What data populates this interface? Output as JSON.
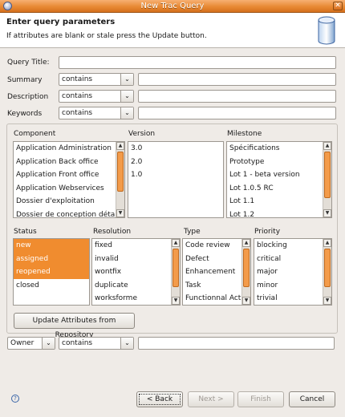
{
  "window": {
    "title": "New Trac Query"
  },
  "header": {
    "title": "Enter query parameters",
    "subtitle": "If attributes are blank or stale press the Update button."
  },
  "fields": {
    "query_title_label": "Query Title:",
    "summary_label": "Summary",
    "summary_op": "contains",
    "description_label": "Description",
    "description_op": "contains",
    "keywords_label": "Keywords",
    "keywords_op": "contains"
  },
  "component": {
    "label": "Component",
    "items": [
      "Application Administration",
      "Application Back office",
      "Application Front office",
      "Application Webservices",
      "Dossier d'exploitation",
      "Dossier de conception détaillé"
    ]
  },
  "version": {
    "label": "Version",
    "items": [
      "3.0",
      "2.0",
      "1.0"
    ]
  },
  "milestone": {
    "label": "Milestone",
    "items": [
      "Spécifications",
      "Prototype",
      "Lot 1 - beta version",
      "Lot 1.0.5 RC",
      "Lot 1.1",
      "Lot 1.2"
    ]
  },
  "status": {
    "label": "Status",
    "items": [
      "new",
      "assigned",
      "reopened",
      "closed"
    ],
    "selected": [
      "new",
      "assigned",
      "reopened"
    ]
  },
  "resolution": {
    "label": "Resolution",
    "items": [
      "fixed",
      "invalid",
      "wontfix",
      "duplicate",
      "worksforme"
    ]
  },
  "type": {
    "label": "Type",
    "items": [
      "Code review",
      "Defect",
      "Enhancement",
      "Task",
      "Functionnal Action"
    ]
  },
  "priority": {
    "label": "Priority",
    "items": [
      "blocking",
      "critical",
      "major",
      "minor",
      "trivial"
    ]
  },
  "update_button": "Update Attributes from Repository",
  "owner_row": {
    "field": "Owner",
    "op": "contains"
  },
  "footer": {
    "back": "< Back",
    "next": "Next >",
    "finish": "Finish",
    "cancel": "Cancel"
  },
  "colors": {
    "accent": "#f08c2f",
    "title_bar": "#e88a34"
  }
}
